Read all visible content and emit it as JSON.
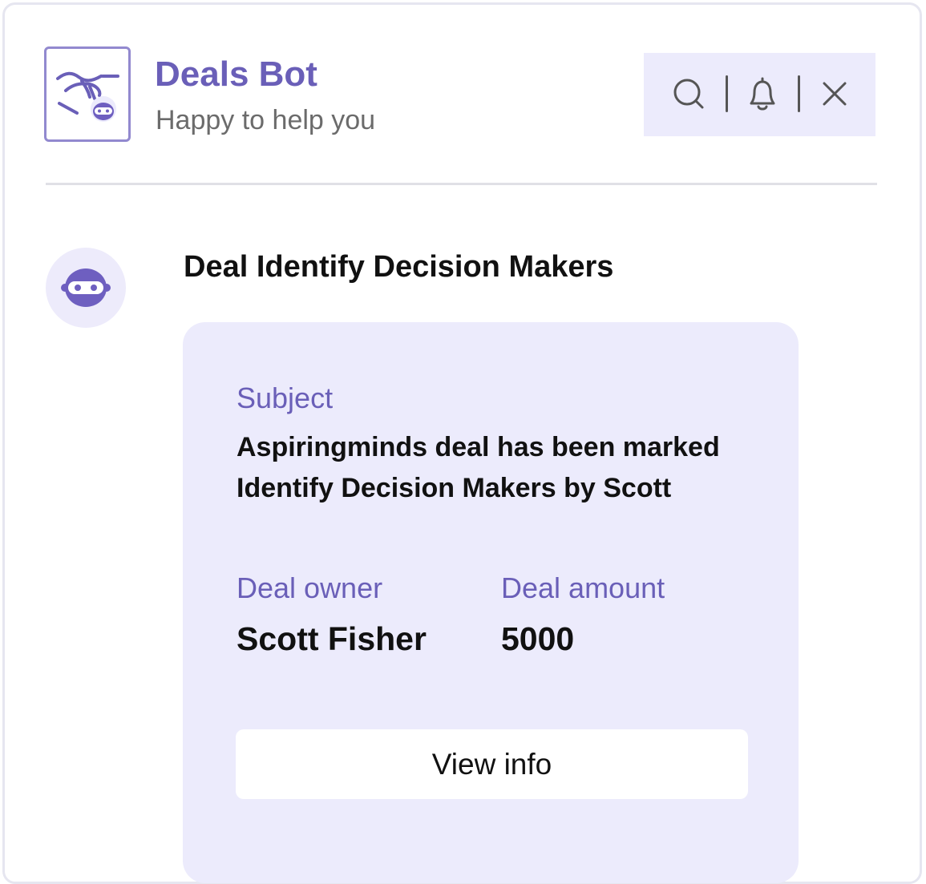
{
  "header": {
    "title": "Deals Bot",
    "subtitle": "Happy to help you",
    "logo_icon": "handshake-bot-icon"
  },
  "toolbar": {
    "icons": [
      "search-icon",
      "bell-icon",
      "close-icon"
    ]
  },
  "message": {
    "avatar_icon": "bot-icon",
    "title": "Deal Identify Decision Makers"
  },
  "card": {
    "subject_label": "Subject",
    "subject_value": "Aspiringminds deal has been marked Identify Decision Makers by Scott",
    "owner_label": "Deal owner",
    "owner_value": "Scott Fisher",
    "amount_label": "Deal amount",
    "amount_value": "5000",
    "button_label": "View info"
  },
  "colors": {
    "accent": "#6a5fb8",
    "card_background": "#ecebfc",
    "bot_face": "#6e5fc0"
  }
}
